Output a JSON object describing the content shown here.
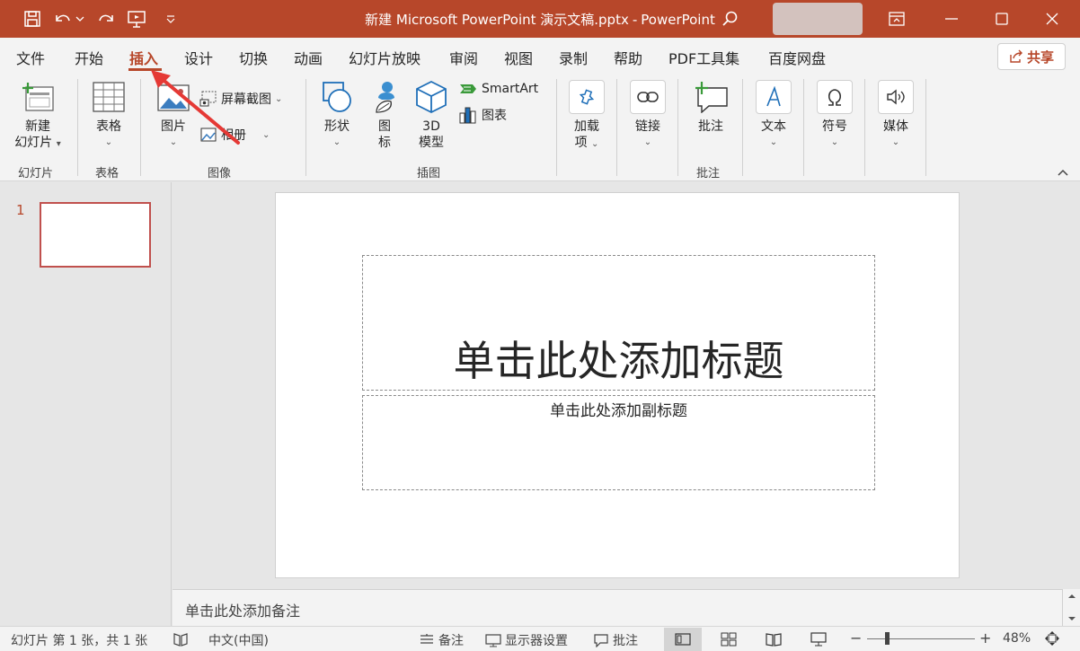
{
  "app": {
    "title": "新建 Microsoft PowerPoint 演示文稿.pptx",
    "separator": "-",
    "app_name": "PowerPoint"
  },
  "colors": {
    "accent": "#b7472a",
    "slide_border": "#c0504d"
  },
  "menu": {
    "tabs": [
      {
        "label": "文件"
      },
      {
        "label": "开始"
      },
      {
        "label": "插入"
      },
      {
        "label": "设计"
      },
      {
        "label": "切换"
      },
      {
        "label": "动画"
      },
      {
        "label": "幻灯片放映"
      },
      {
        "label": "审阅"
      },
      {
        "label": "视图"
      },
      {
        "label": "录制"
      },
      {
        "label": "帮助"
      },
      {
        "label": "PDF工具集"
      },
      {
        "label": "百度网盘"
      }
    ],
    "share": "共享"
  },
  "ribbon": {
    "new_slide_1": "新建",
    "new_slide_2": "幻灯片",
    "table": "表格",
    "picture": "图片",
    "screenshot": "屏幕截图",
    "album": "相册",
    "shapes": "形状",
    "icons_1": "图",
    "icons_2": "标",
    "model_1": "3D",
    "model_2": "模型",
    "smartart": "SmartArt",
    "chart": "图表",
    "addins_1": "加载",
    "addins_2": "项",
    "link": "链接",
    "comment": "批注",
    "text": "文本",
    "symbol": "符号",
    "media": "媒体",
    "groups": {
      "slides": "幻灯片",
      "tables": "表格",
      "images": "图像",
      "illustrations": "插图",
      "comments": "批注"
    }
  },
  "thumbs": {
    "number": "1"
  },
  "slide": {
    "title_placeholder": "单击此处添加标题",
    "subtitle_placeholder": "单击此处添加副标题"
  },
  "notes": {
    "placeholder": "单击此处添加备注"
  },
  "status": {
    "slide_info": "幻灯片 第 1 张，共 1 张",
    "language": "中文(中国)",
    "notes": "备注",
    "display": "显示器设置",
    "comments": "批注",
    "zoom_minus": "−",
    "zoom_plus": "+",
    "zoom": "48%",
    "zoom_fraction": 0.48
  }
}
